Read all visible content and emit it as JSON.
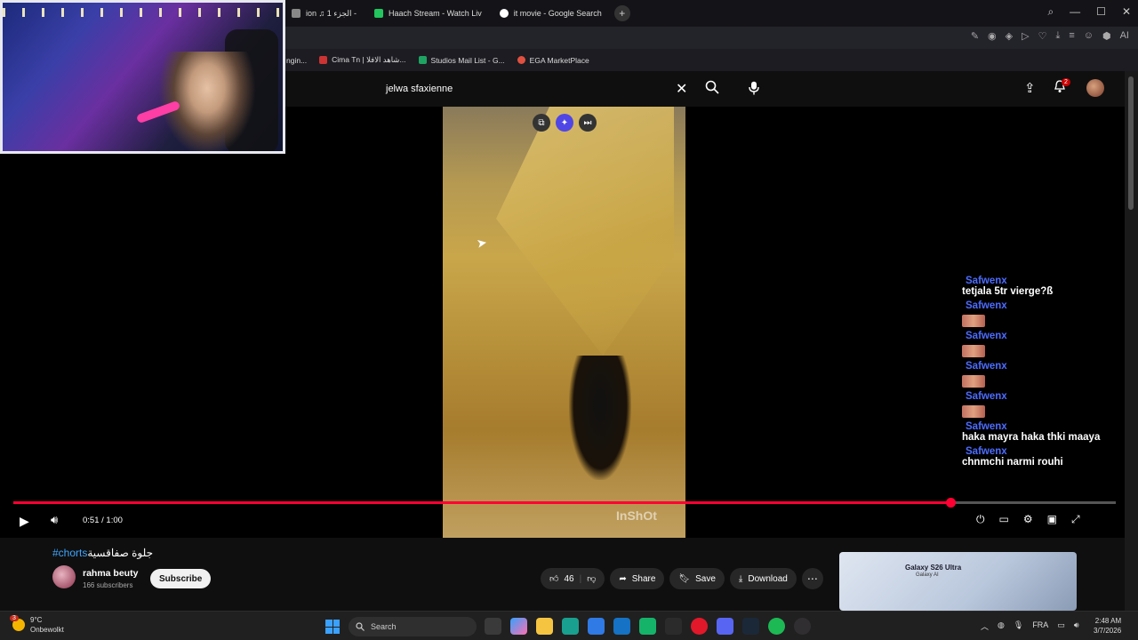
{
  "browser": {
    "tabs": [
      {
        "label": "ion ♫ الجزء 1 -",
        "color": "#888888"
      },
      {
        "label": "Haach Stream - Watch Liv",
        "color": "#22c55e"
      },
      {
        "label": "it movie - Google Search",
        "color": "#ffffff"
      }
    ],
    "new_tab": "+",
    "bookmarks": [
      {
        "label": "ngin...",
        "color": "#999999"
      },
      {
        "label": "Cima Tn | شاهد الافلا...",
        "color": "#cc3333"
      },
      {
        "label": "Studios Mail List - G...",
        "color": "#1ea362"
      },
      {
        "label": "EGA MarketPlace",
        "color": "#e05040"
      }
    ],
    "toolbar_ai": "AI"
  },
  "youtube": {
    "search": {
      "query": "jelwa sfaxienne"
    },
    "notifications": "2",
    "video": {
      "watermark": "InShOt",
      "time": "0:51 / 1:00",
      "progress": 0.85
    },
    "title_tag": "#chorts",
    "title_text": "جلوة صفاقسية",
    "channel": {
      "name": "rahma beuty",
      "subscribers": "166 subscribers",
      "subscribe_label": "Subscribe"
    },
    "actions": {
      "likes": "46",
      "share": "Share",
      "save": "Save",
      "download": "Download"
    },
    "ad": {
      "title": "Galaxy S26 Ultra",
      "subtitle": "Galaxy AI"
    }
  },
  "chat": [
    {
      "user": "Safwenx",
      "msg": "tetjala 5tr vierge?ß",
      "emote": false
    },
    {
      "user": "Safwenx",
      "msg": "",
      "emote": true
    },
    {
      "user": "Safwenx",
      "msg": "",
      "emote": true
    },
    {
      "user": "Safwenx",
      "msg": "",
      "emote": true
    },
    {
      "user": "Safwenx",
      "msg": "",
      "emote": true
    },
    {
      "user": "Safwenx",
      "msg": "haka mayra haka thki maaya",
      "emote": false
    },
    {
      "user": "Safwenx",
      "msg": "chnmchi narmi rouhi",
      "emote": false
    }
  ],
  "taskbar": {
    "weather_temp": "9°C",
    "weather_desc": "Onbewolkt",
    "weather_badge": "3",
    "search_placeholder": "Search",
    "lang": "FRA",
    "time": "2:48 AM",
    "date": "3/7/2026"
  }
}
